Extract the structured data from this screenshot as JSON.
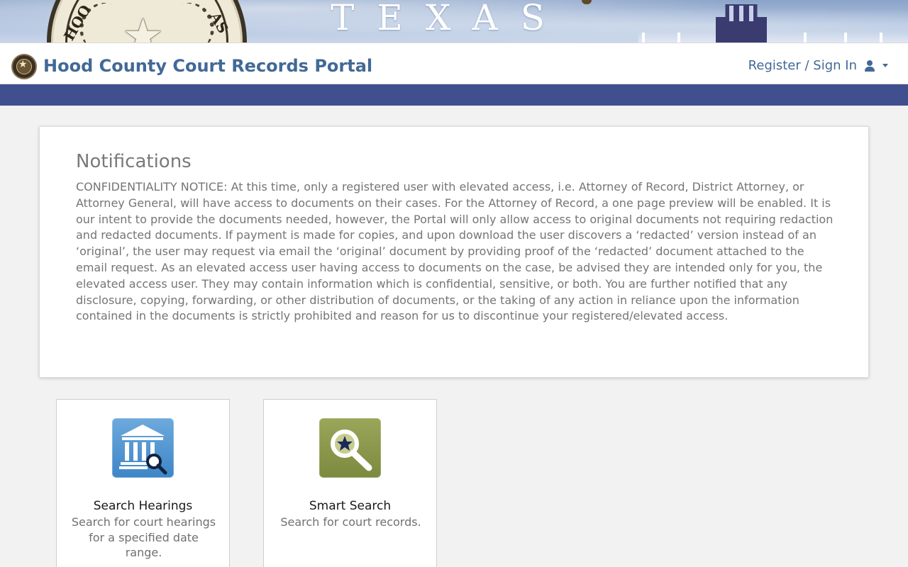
{
  "banner": {
    "state_text": "TEXAS",
    "seal_left_letters": "HOO",
    "seal_right_letters": "AS"
  },
  "header": {
    "brand_title": "Hood County Court Records Portal",
    "signin_label": "Register / Sign In",
    "signin_icon": "user-icon",
    "signin_caret": "caret-down-icon"
  },
  "notifications": {
    "heading": "Notifications",
    "body": "CONFIDENTIALITY NOTICE: At this time, only a registered user with elevated access, i.e. Attorney of Record, District Attorney, or Attorney General, will have access to documents on their cases. For the Attorney of Record, a one page preview will be enabled. It is our intent to provide the documents needed, however, the Portal will only allow access to original documents not requiring redaction and redacted documents. If payment is made for copies, and upon download the user discovers a ‘redacted’ version instead of an ‘original’, the user may request via email the ‘original’ document by providing proof of the ‘redacted’ document attached to the email request. As an elevated access user having access to documents on the case, be advised they are intended only for you, the elevated access user. They may contain information which is confidential, sensitive, or both. You are further notified that any disclosure, copying, forwarding, or other distribution of documents, or the taking of any action in reliance upon the information contained in the documents is strictly prohibited and reason for us to discontinue your registered/elevated access."
  },
  "cards": [
    {
      "title": "Search Hearings",
      "description": "Search for court hearings for a specified date range.",
      "icon": "courthouse-search-icon",
      "color": "#4a90d0"
    },
    {
      "title": "Smart Search",
      "description": "Search for court records.",
      "icon": "magnifier-star-icon",
      "color": "#8a9848"
    }
  ],
  "colors": {
    "brand_blue": "#426996",
    "nav_stripe": "#40508f"
  }
}
